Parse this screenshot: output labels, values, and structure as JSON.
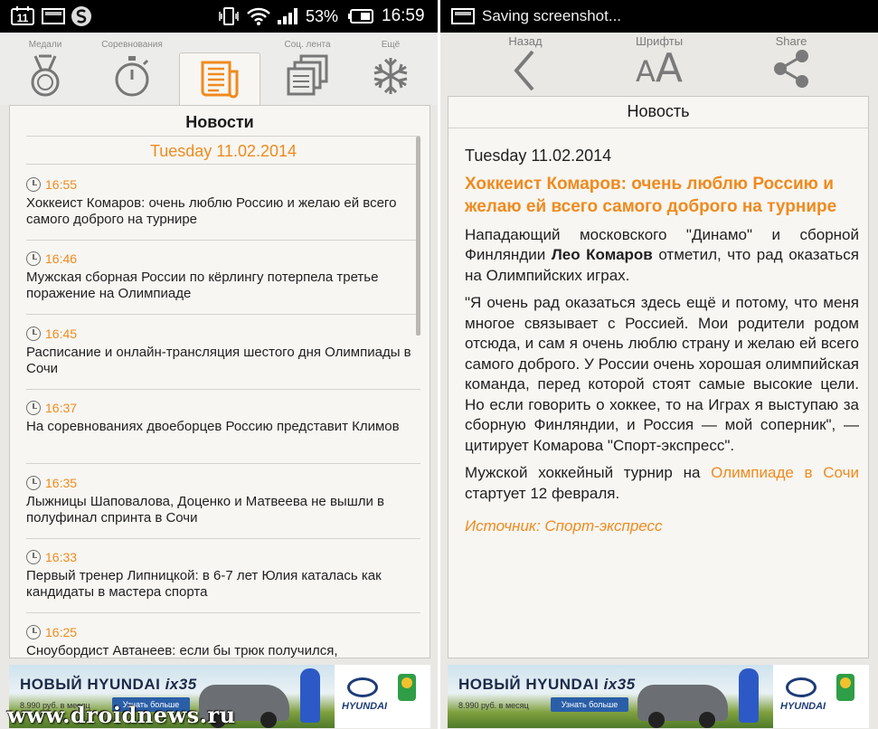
{
  "left_screen": {
    "status_bar": {
      "notification_badge": "11",
      "battery_percent": "53%",
      "time": "16:59"
    },
    "tabs": [
      {
        "label": "Медали",
        "icon": "medal-icon"
      },
      {
        "label": "Соревнования",
        "icon": "stopwatch-icon"
      },
      {
        "label": "",
        "icon": "newspaper-icon",
        "active": true
      },
      {
        "label": "Соц. лента",
        "icon": "stacked-pages-icon"
      },
      {
        "label": "Ещё",
        "icon": "snowflake-icon"
      }
    ],
    "section_title": "Новости",
    "date": "Tuesday 11.02.2014",
    "news": [
      {
        "time": "16:55",
        "title": "Хоккеист Комаров: очень люблю Россию и желаю ей всего самого доброго на турнире"
      },
      {
        "time": "16:46",
        "title": "Мужская сборная России по кёрлингу потерпела третье поражение на Олимпиаде"
      },
      {
        "time": "16:45",
        "title": "Расписание и онлайн-трансляция шестого дня Олимпиады в Сочи"
      },
      {
        "time": "16:37",
        "title": "На соревнованиях двоеборцев Россию представит Климов"
      },
      {
        "time": "16:35",
        "title": "Лыжницы Шаповалова, Доценко и Матвеева не вышли в полуфинал спринта в Сочи"
      },
      {
        "time": "16:33",
        "title": "Первый тренер Липницкой: в 6-7 лет Юлия каталась как кандидаты в мастера спорта"
      },
      {
        "time": "16:25",
        "title": "Сноубордист Автанеев: если бы трюк получился,"
      }
    ],
    "watermark": "www.droidnews.ru"
  },
  "ad": {
    "headline_prefix": "НОВЫЙ",
    "headline_brand": "HYUNDAI",
    "headline_model": "ix35",
    "price_text": "8.990 руб. в месяц",
    "button_label": "Узнать больше",
    "brand_logo_text": "HYUNDAI",
    "colors": {
      "accent": "#f08a1e",
      "button": "#2a5fa8"
    }
  },
  "right_screen": {
    "status_bar": {
      "text": "Saving screenshot..."
    },
    "toolbar": {
      "back_label": "Назад",
      "fonts_label": "Шрифты",
      "fonts_glyph": "AA",
      "share_label": "Share"
    },
    "section_title": "Новость",
    "article": {
      "date": "Tuesday 11.02.2014",
      "headline": "Хоккеист Комаров: очень люблю Россию и желаю ей всего самого доброго на турнире",
      "p1_before": "Нападающий московского \"Динамо\" и сборной Финляндии ",
      "p1_bold": "Лео Комаров",
      "p1_after": " отметил, что рад оказаться на Олимпийских играх.",
      "p2": "\"Я очень рад оказаться здесь ещё и потому, что меня многое связывает с Россией. Мои родители родом отсюда, и сам я очень люблю страну и желаю ей всего самого доброго. У России очень хорошая олимпийская команда, перед которой стоят самые высокие цели. Но если говорить о хоккее, то на Играх я выступаю за сборную Финляндии, и Россия — мой соперник\", — цитирует Комарова \"Спорт-экспресс\".",
      "p3_before": "Мужской хоккейный турнир на ",
      "p3_link": "Олимпиаде в Сочи",
      "p3_after": " стартует 12 февраля.",
      "source": "Источник: Спорт-экспресс"
    }
  }
}
